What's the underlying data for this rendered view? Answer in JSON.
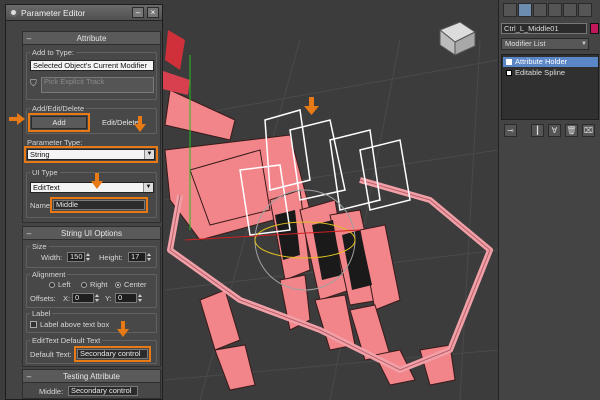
{
  "window": {
    "title": "Parameter Editor"
  },
  "attribute": {
    "header": "Attribute",
    "add_to_type_label": "Add to Type:",
    "add_to_type_value": "Selected Object's Current Modifier",
    "pick_track_label": "Pick Explicit Track"
  },
  "add_edit_delete": {
    "label": "Add/Edit/Delete",
    "add_label": "Add",
    "edit_delete_label": "Edit/Delete..."
  },
  "parameter_type": {
    "label": "Parameter Type:",
    "value": "String"
  },
  "ui_type": {
    "label": "UI Type",
    "value": "EditText",
    "name_label": "Name:",
    "name_value": "Middle"
  },
  "string_ui_options": {
    "header": "String UI Options",
    "size_label": "Size",
    "width_label": "Width:",
    "width_value": "150",
    "height_label": "Height:",
    "height_value": "17",
    "alignment_label": "Alignment",
    "left_label": "Left",
    "right_label": "Right",
    "center_label": "Center",
    "offsets_label": "Offsets:",
    "x_label": "X:",
    "x_value": "0",
    "y_label": "Y:",
    "y_value": "0",
    "label_group": "Label",
    "label_above_label": "Label above text box",
    "edittext_default_label": "EditText Default Text",
    "default_text_label": "Default Text:",
    "default_text_value": "Secondary control"
  },
  "testing_attribute": {
    "header": "Testing Attribute",
    "middle_label": "Middle:",
    "middle_value": "Secondary control"
  },
  "command_panel": {
    "object_name": "Ctrl_L_Middle01",
    "object_color": "#c2185b",
    "modifier_list_label": "Modifier List",
    "stack": [
      "Attribute Holder",
      "Editable Spline"
    ]
  },
  "colors": {
    "highlight": "#e87a15",
    "selected": "#5b86c8",
    "mesh": "#f2858a"
  }
}
